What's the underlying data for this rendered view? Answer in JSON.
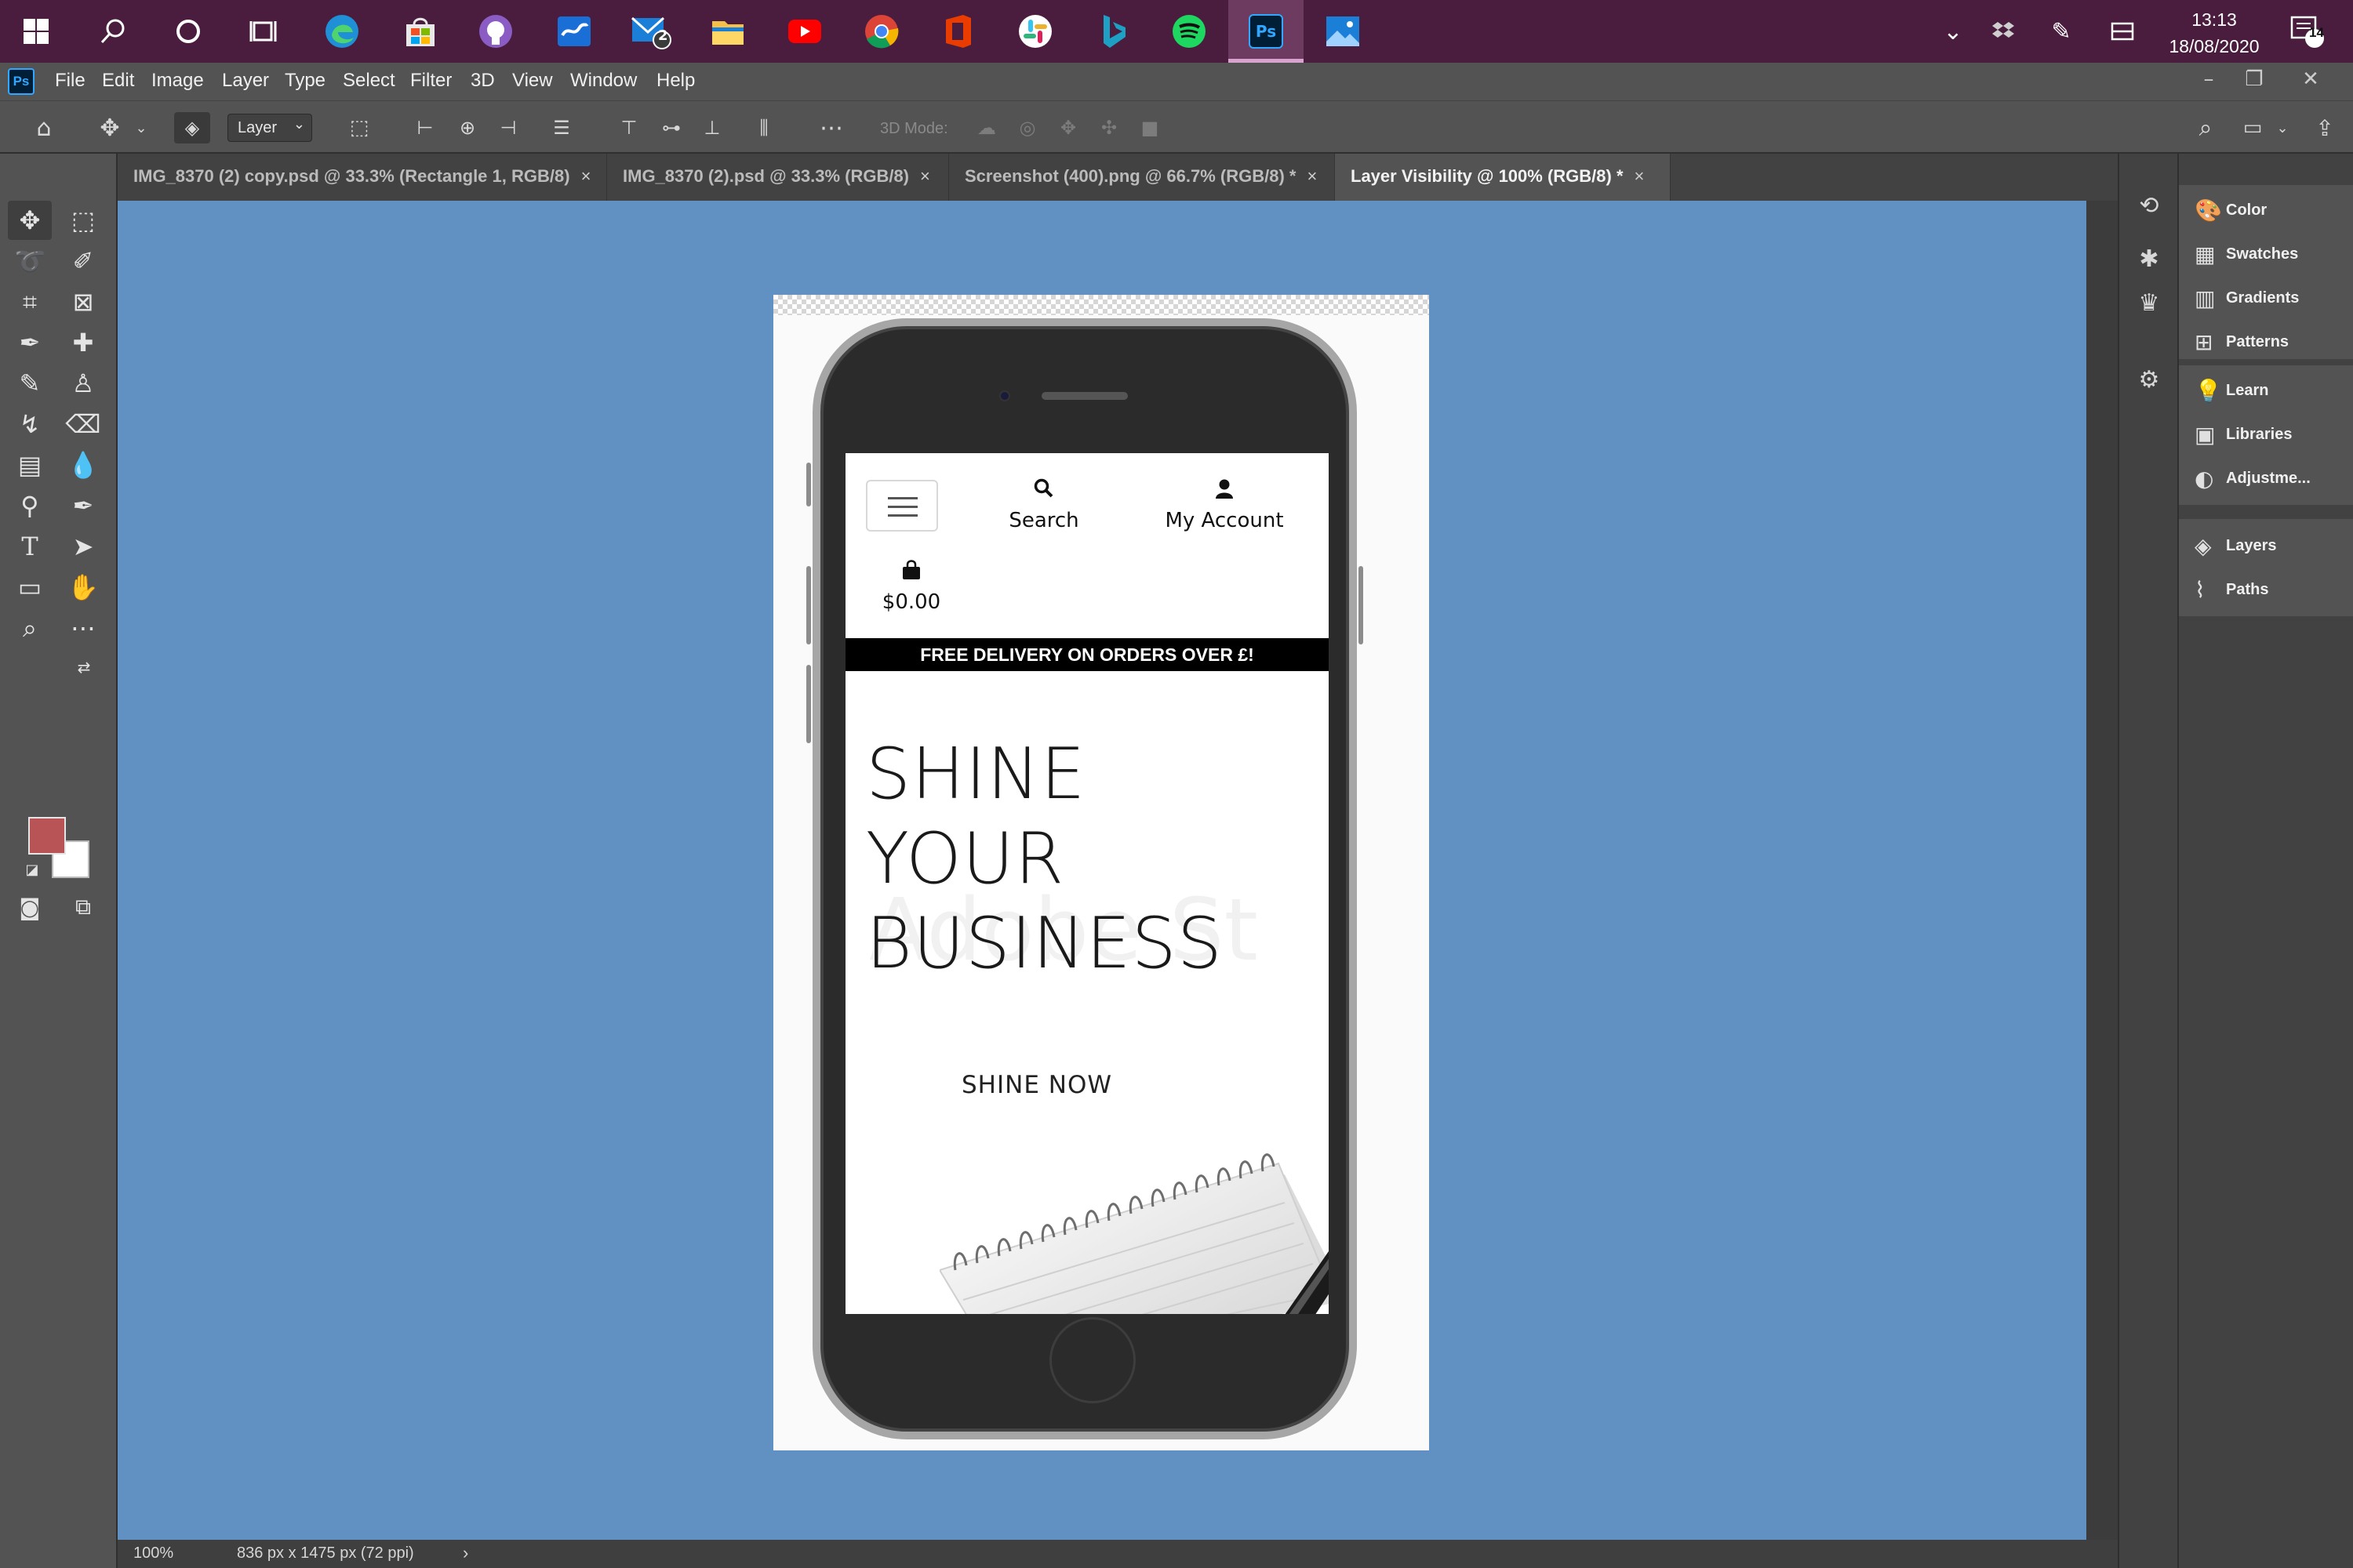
{
  "taskbar": {
    "time": "13:13",
    "date": "18/08/2020",
    "mail_badge": "2",
    "notif_count": "14",
    "ps_label": "Ps"
  },
  "menubar": {
    "logo": "Ps",
    "items": [
      "File",
      "Edit",
      "Image",
      "Layer",
      "Type",
      "Select",
      "Filter",
      "3D",
      "View",
      "Window",
      "Help"
    ]
  },
  "options": {
    "layer_select": "Layer",
    "mode_3d": "3D Mode:"
  },
  "tabs": [
    {
      "label": "IMG_8370 (2) copy.psd @ 33.3% (Rectangle 1, RGB/8)"
    },
    {
      "label": "IMG_8370 (2).psd @ 33.3% (RGB/8)"
    },
    {
      "label": "Screenshot (400).png @ 66.7% (RGB/8) *"
    },
    {
      "label": "Layer Visibility @ 100% (RGB/8) *"
    }
  ],
  "tab_close": "×",
  "colors": {
    "foreground": "#b85456",
    "background": "#ffffff",
    "canvas_bg": "#6190c2"
  },
  "statusbar": {
    "zoom": "100%",
    "doc_info": "836 px x 1475 px (72 ppi)",
    "arrow": "›"
  },
  "mockup": {
    "search": "Search",
    "account": "My Account",
    "cart_total": "$0.00",
    "banner": "FREE DELIVERY ON ORDERS OVER £!",
    "hero_lines": [
      "SHINE",
      "YOUR",
      "BUSINESS"
    ],
    "watermark": "Adobe St",
    "cta": "SHINE NOW"
  },
  "panels": {
    "items": [
      "Color",
      "Swatches",
      "Gradients",
      "Patterns",
      "Learn",
      "Libraries",
      "Adjustme...",
      "Layers",
      "Paths"
    ]
  }
}
